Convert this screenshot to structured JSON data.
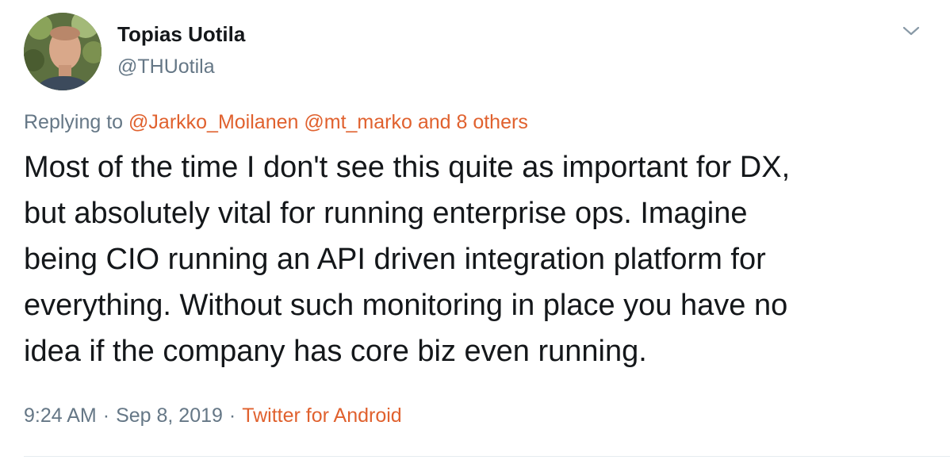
{
  "author": {
    "display_name": "Topias Uotila",
    "handle": "@THUotila"
  },
  "reply": {
    "prefix": "Replying to",
    "mentions": [
      "@Jarkko_Moilanen",
      "@mt_marko"
    ],
    "others": "and 8 others"
  },
  "tweet": {
    "lines": [
      "Most of the time I don't see this quite as important for DX,",
      "but absolutely vital for running enterprise ops. Imagine",
      "being CIO running an API driven integration platform for",
      "everything. Without such monitoring in place you have no",
      "idea if the company has core biz even running."
    ]
  },
  "meta": {
    "time": "9:24 AM",
    "date": "Sep 8, 2019",
    "separator": "·",
    "source": "Twitter for Android"
  },
  "icons": {
    "avatar": "avatar-photo",
    "menu": "chevron-down-icon"
  },
  "colors": {
    "link": "#e0612e",
    "muted": "#657786",
    "text": "#14171a"
  }
}
